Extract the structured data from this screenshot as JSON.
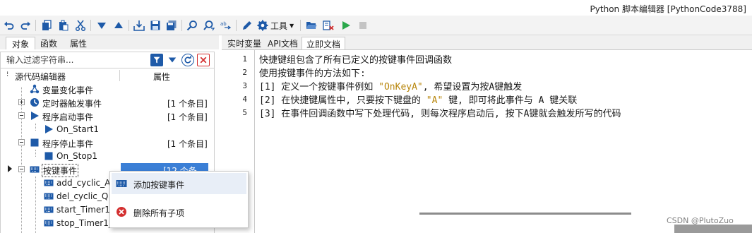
{
  "window": {
    "title": "Python 脚本编辑器 [PythonCode3788]"
  },
  "toolbar": {
    "tools_label": "工具",
    "icons": [
      "undo-icon",
      "redo-icon",
      "copy-icon",
      "paste-icon",
      "cut-icon",
      "move-down-icon",
      "move-up-icon",
      "import-icon",
      "save-icon",
      "save-all-icon",
      "find-icon",
      "find-replace-icon",
      "replace-icon",
      "edit-icon",
      "gear-icon",
      "open-folder-icon",
      "clear-icon",
      "run-icon",
      "stop-icon"
    ]
  },
  "left_tabs": [
    "对象",
    "函数",
    "属性"
  ],
  "filter": {
    "placeholder": "输入过滤字符串..."
  },
  "tree": {
    "header": {
      "col1": "源代码编辑器",
      "col2": "属性"
    },
    "rows": [
      {
        "label": "变量变化事件",
        "count": ""
      },
      {
        "label": "定时器触发事件",
        "count": "[1 个条目]"
      },
      {
        "label": "程序启动事件",
        "count": "[1 个条目]"
      },
      {
        "label": "On_Start1",
        "count": ""
      },
      {
        "label": "程序停止事件",
        "count": "[1 个条目]"
      },
      {
        "label": "On_Stop1",
        "count": ""
      },
      {
        "label": "按键事件",
        "count": "[12 个条目]"
      },
      {
        "label": "add_cyclic_A",
        "count": ""
      },
      {
        "label": "del_cyclic_Q",
        "count": ""
      },
      {
        "label": "start_Timer1_",
        "count": ""
      },
      {
        "label": "stop_Timer1_",
        "count": ""
      }
    ]
  },
  "context_menu": {
    "items": [
      {
        "label": "添加按键事件",
        "icon": "keyboard-icon"
      },
      {
        "label": "删除所有子项",
        "icon": "delete-icon"
      }
    ]
  },
  "right_tabs": [
    "实时变量",
    "API文档",
    "立即文档"
  ],
  "editor": {
    "line_numbers": [
      "1",
      "2",
      "3",
      "4",
      "5"
    ],
    "lines": [
      {
        "pre": "快捷键组包含了所有已定义的按键事件回调函数",
        "str": "",
        "post": ""
      },
      {
        "pre": "使用按键事件的方法如下:",
        "str": "",
        "post": ""
      },
      {
        "pre": "[1] 定义一个按键事件例如 ",
        "str": "\"OnKeyA\"",
        "post": ", 希望设置为按A键触发"
      },
      {
        "pre": "[2] 在快捷键属性中, 只要按下键盘的 ",
        "str": "\"A\"",
        "post": " 键, 即可将此事件与 A 键关联"
      },
      {
        "pre": "[3] 在事件回调函数中写下处理代码, 则每次程序启动后, 按下A键就会触发所写的代码",
        "str": "",
        "post": ""
      }
    ]
  },
  "watermark": "CSDN @PlutoZuo",
  "colors": {
    "accent_blue": "#1e5aa8",
    "selection": "#3b7fd6",
    "run_green": "#2aa84a",
    "delete_red": "#d32f2f",
    "string_color": "#b8860b"
  }
}
